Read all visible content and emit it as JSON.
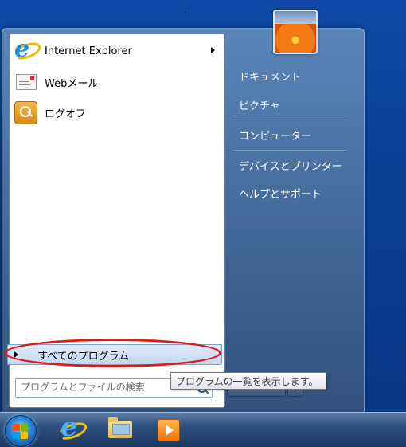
{
  "start_menu": {
    "pinned_programs": [
      {
        "label": "Internet Explorer",
        "icon": "internet-explorer-icon",
        "has_submenu": true
      },
      {
        "label": "Webメール",
        "icon": "mail-icon",
        "has_submenu": false
      },
      {
        "label": "ログオフ",
        "icon": "logoff-key-icon",
        "has_submenu": false
      }
    ],
    "all_programs_label": "すべてのプログラム",
    "search": {
      "placeholder": "プログラムとファイルの検索",
      "value": ""
    },
    "right_pane": {
      "user_picture_icon": "user-picture-flower",
      "items": [
        {
          "label": "ドキュメント"
        },
        {
          "label": "ピクチャ"
        },
        {
          "label": "コンピューター"
        },
        {
          "label": "デバイスとプリンター"
        },
        {
          "label": "ヘルプとサポート"
        }
      ]
    },
    "tooltip": "プログラムの一覧を表示します。"
  },
  "annotation": {
    "shape": "ellipse",
    "color": "#e01818",
    "target": "all-programs"
  },
  "taskbar": {
    "items": [
      {
        "icon": "windows-start-orb-icon"
      },
      {
        "icon": "internet-explorer-icon"
      },
      {
        "icon": "windows-explorer-folder-icon"
      },
      {
        "icon": "media-player-icon"
      }
    ]
  }
}
